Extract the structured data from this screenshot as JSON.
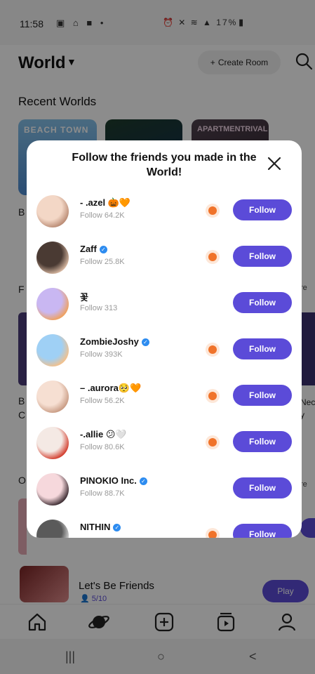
{
  "status_bar": {
    "time": "11:58",
    "left_icons": "▣ ⌂ ■ •",
    "right_icons": "⏰ ✕ ≋ ▲ 17%",
    "battery_glyph": "▮"
  },
  "header": {
    "title": "World",
    "caret": "▼",
    "create_room": "Create Room",
    "create_room_plus": "+"
  },
  "recent": {
    "title": "Recent Worlds",
    "cards": [
      {
        "label": "BEACH TOWN"
      },
      {
        "label": ""
      },
      {
        "label": "APARTMENTRIVAL"
      }
    ]
  },
  "background_peeks": {
    "b1": "B",
    "f": "F",
    "b2": "B",
    "c": "C",
    "o": "O",
    "ore1": "re",
    "ore2": "re",
    "nec": "Nec",
    "y": "y"
  },
  "friends_room": {
    "title": "Let's Be Friends",
    "count": "5/10",
    "play": "Play"
  },
  "tabs": [
    {
      "icon": "home-icon"
    },
    {
      "icon": "planet-icon"
    },
    {
      "icon": "add-icon"
    },
    {
      "icon": "video-icon"
    },
    {
      "icon": "profile-icon"
    }
  ],
  "nav": {
    "recent": "|||",
    "home": "○",
    "back": "<"
  },
  "modal": {
    "title": "Follow the friends you made in the World!",
    "close_glyph": "✕",
    "follow_label": "Follow",
    "friends": [
      {
        "name": "- .azel 🎃🧡",
        "verified": false,
        "followers": "Follow 64.2K",
        "live": true,
        "avatar_colors": [
          "#f3d7c6",
          "#b98a73"
        ]
      },
      {
        "name": "Zaff",
        "verified": true,
        "followers": "Follow 25.8K",
        "live": true,
        "avatar_colors": [
          "#4a3a33",
          "#d9b9a2"
        ]
      },
      {
        "name": "꽃",
        "verified": false,
        "followers": "Follow 313",
        "live": false,
        "avatar_colors": [
          "#c9b7f2",
          "#f0a05a"
        ]
      },
      {
        "name": "ZombieJoshy",
        "verified": true,
        "followers": "Follow 393K",
        "live": true,
        "avatar_colors": [
          "#9fd0f5",
          "#f4c08a"
        ]
      },
      {
        "name": "– .aurora🥺🧡",
        "verified": false,
        "followers": "Follow 56.2K",
        "live": true,
        "avatar_colors": [
          "#f6dfd2",
          "#c89a82"
        ]
      },
      {
        "name": "-.allie 😕🤍",
        "verified": false,
        "followers": "Follow 80.6K",
        "live": true,
        "avatar_colors": [
          "#f4e9e4",
          "#d23a2a"
        ]
      },
      {
        "name": "PINOKIO Inc.",
        "verified": true,
        "followers": "Follow 88.7K",
        "live": false,
        "avatar_colors": [
          "#f6d8dc",
          "#3a2a30"
        ]
      },
      {
        "name": "NITHIN",
        "verified": true,
        "followers": "",
        "live": true,
        "avatar_colors": [
          "#5a5a5a",
          "#d9d9d9"
        ]
      }
    ]
  },
  "colors": {
    "accent": "#5b4bd8",
    "live": "#f0732a",
    "verified": "#2d8cf0"
  }
}
